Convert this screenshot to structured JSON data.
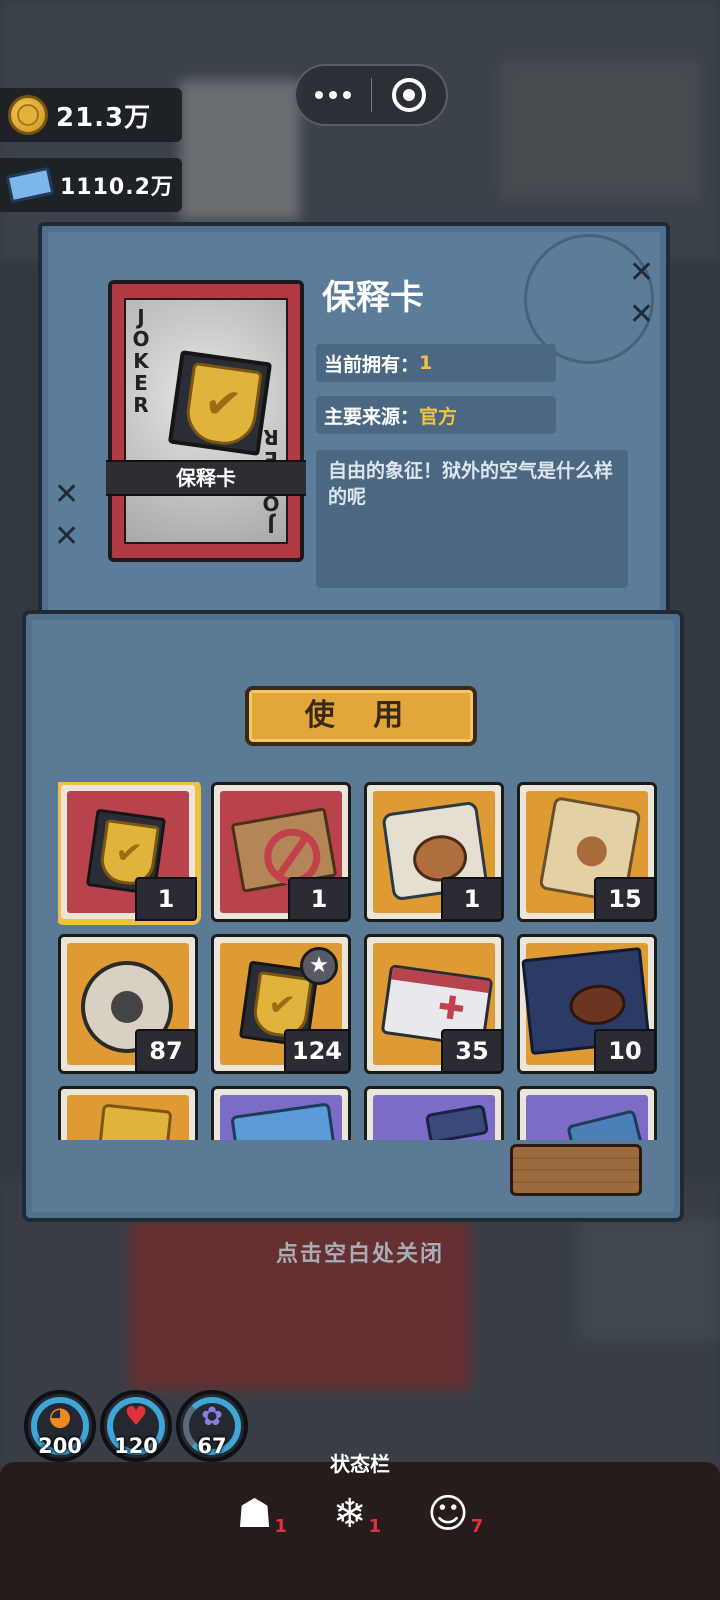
{
  "currency": {
    "coins": "21.3万",
    "tickets": "1110.2万"
  },
  "item": {
    "card_top_letters": [
      "J",
      "O",
      "K",
      "E",
      "R"
    ],
    "card_bottom_letters": [
      "J",
      "O",
      "K",
      "E",
      "R"
    ],
    "card_banner": "保释卡",
    "title": "保释卡",
    "owned_label": "当前拥有：",
    "owned_value": "1",
    "source_label": "主要来源：",
    "source_value": "官方",
    "description": "自由的象征！狱外的空气是什么样的呢"
  },
  "actions": {
    "use_label": "使 用"
  },
  "inventory": [
    {
      "icon": "bail-card-icon",
      "bg": "red",
      "count": "1",
      "selected": true
    },
    {
      "icon": "no-entry-card-icon",
      "bg": "red",
      "count": "1"
    },
    {
      "icon": "capybara-bag-icon",
      "bg": "orange",
      "count": "1"
    },
    {
      "icon": "paw-scroll-icon",
      "bg": "orange",
      "count": "15"
    },
    {
      "icon": "film-reel-icon",
      "bg": "orange",
      "count": "87"
    },
    {
      "icon": "star-bail-card-icon",
      "bg": "orange",
      "count": "124"
    },
    {
      "icon": "medkit-card-icon",
      "bg": "orange",
      "count": "35"
    },
    {
      "icon": "steak-meal-icon",
      "bg": "orange",
      "count": "10"
    },
    {
      "icon": "gold-item-icon",
      "bg": "orange",
      "count": ""
    },
    {
      "icon": "blue-ticket-icon",
      "bg": "purple",
      "count": ""
    },
    {
      "icon": "dark-item-icon",
      "bg": "purple",
      "count": ""
    },
    {
      "icon": "blue-item-icon",
      "bg": "purple",
      "count": ""
    }
  ],
  "hint": "点击空白处关闭",
  "stats": {
    "hunger": "200",
    "health": "120",
    "mind": "67"
  },
  "status_bar": {
    "title": "状态栏",
    "effects": [
      {
        "icon": "tired-icon",
        "count": "1"
      },
      {
        "icon": "cold-icon",
        "count": "1"
      },
      {
        "icon": "mask-icon",
        "count": "7"
      }
    ]
  },
  "colors": {
    "accent_gold": "#f3c240",
    "panel_blue": "#5c7d9a",
    "slot_red": "#b8434c",
    "slot_orange": "#de9a33",
    "slot_purple": "#7c6cc8"
  }
}
